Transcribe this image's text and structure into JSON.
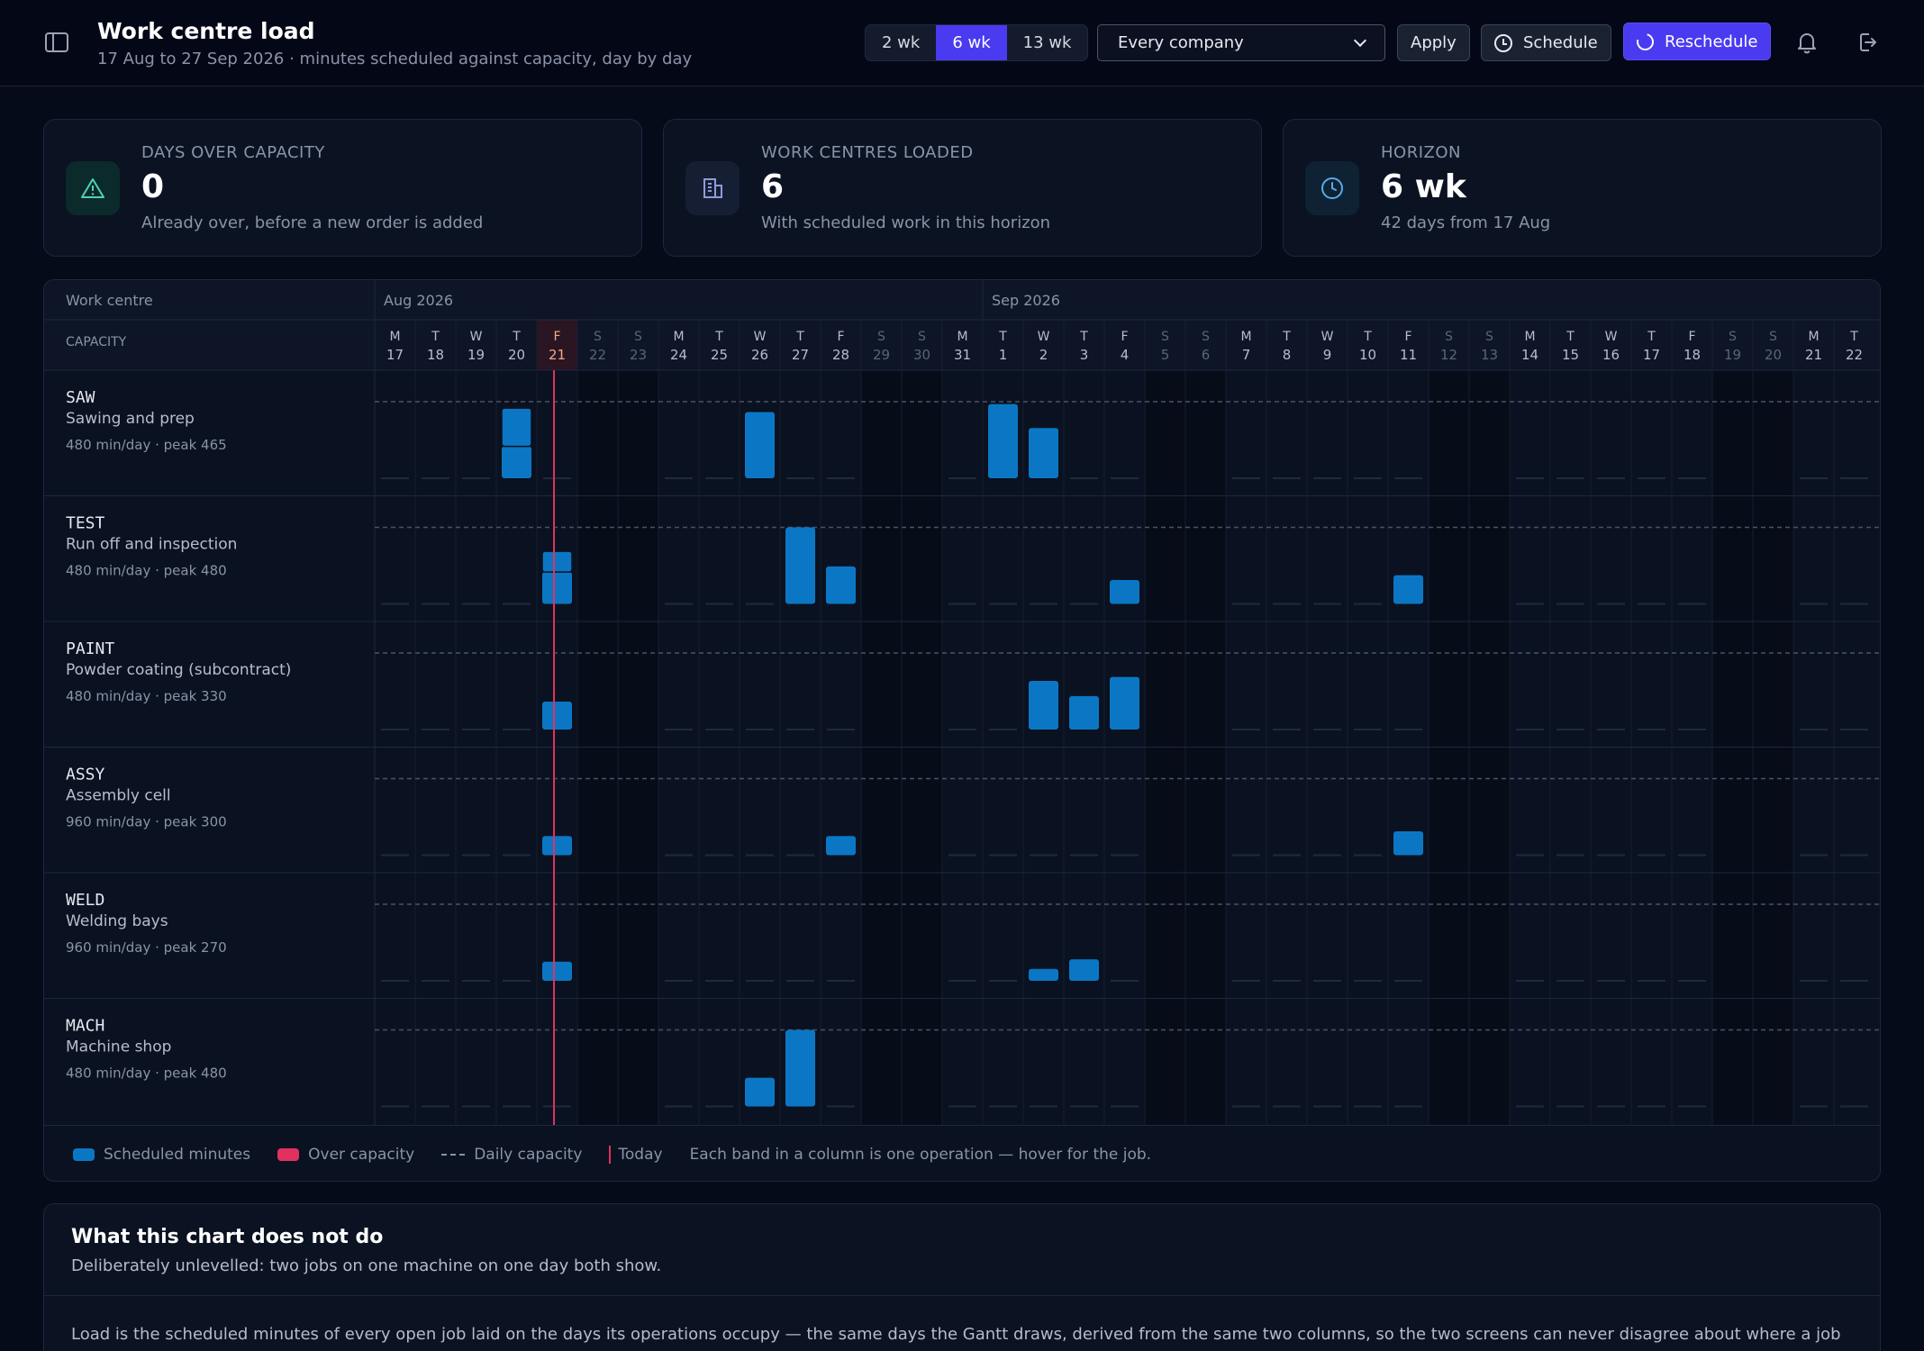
{
  "header": {
    "title": "Work centre load",
    "subtitle": "17 Aug to 27 Sep 2026 · minutes scheduled against capacity, day by day",
    "ranges": [
      "2 wk",
      "6 wk",
      "13 wk"
    ],
    "active_range": 1,
    "company_filter": "Every company",
    "apply_label": "Apply",
    "schedule_label": "Schedule",
    "reschedule_label": "Reschedule"
  },
  "stats": [
    {
      "label": "DAYS OVER CAPACITY",
      "value": "0",
      "note": "Already over, before a new order is added",
      "icon": "warning-icon"
    },
    {
      "label": "WORK CENTRES LOADED",
      "value": "6",
      "note": "With scheduled work in this horizon",
      "icon": "building-icon"
    },
    {
      "label": "HORIZON",
      "value": "6 wk",
      "note": "42 days from 17 Aug",
      "icon": "clock-icon"
    }
  ],
  "chart_data": {
    "type": "bar",
    "header_label": "Work centre",
    "capacity_label": "CAPACITY",
    "months": [
      {
        "label": "Aug 2026",
        "start_index": 0
      },
      {
        "label": "Sep 2026",
        "start_index": 15
      }
    ],
    "days": [
      {
        "dow": "M",
        "d": "17"
      },
      {
        "dow": "T",
        "d": "18"
      },
      {
        "dow": "W",
        "d": "19"
      },
      {
        "dow": "T",
        "d": "20"
      },
      {
        "dow": "F",
        "d": "21"
      },
      {
        "dow": "S",
        "d": "22"
      },
      {
        "dow": "S",
        "d": "23"
      },
      {
        "dow": "M",
        "d": "24"
      },
      {
        "dow": "T",
        "d": "25"
      },
      {
        "dow": "W",
        "d": "26"
      },
      {
        "dow": "T",
        "d": "27"
      },
      {
        "dow": "F",
        "d": "28"
      },
      {
        "dow": "S",
        "d": "29"
      },
      {
        "dow": "S",
        "d": "30"
      },
      {
        "dow": "M",
        "d": "31"
      },
      {
        "dow": "T",
        "d": "1"
      },
      {
        "dow": "W",
        "d": "2"
      },
      {
        "dow": "T",
        "d": "3"
      },
      {
        "dow": "F",
        "d": "4"
      },
      {
        "dow": "S",
        "d": "5"
      },
      {
        "dow": "S",
        "d": "6"
      },
      {
        "dow": "M",
        "d": "7"
      },
      {
        "dow": "T",
        "d": "8"
      },
      {
        "dow": "W",
        "d": "9"
      },
      {
        "dow": "T",
        "d": "10"
      },
      {
        "dow": "F",
        "d": "11"
      },
      {
        "dow": "S",
        "d": "12"
      },
      {
        "dow": "S",
        "d": "13"
      },
      {
        "dow": "M",
        "d": "14"
      },
      {
        "dow": "T",
        "d": "15"
      },
      {
        "dow": "W",
        "d": "16"
      },
      {
        "dow": "T",
        "d": "17"
      },
      {
        "dow": "F",
        "d": "18"
      },
      {
        "dow": "S",
        "d": "19"
      },
      {
        "dow": "S",
        "d": "20"
      },
      {
        "dow": "M",
        "d": "21"
      },
      {
        "dow": "T",
        "d": "22"
      }
    ],
    "today_index": 4,
    "work_centres": [
      {
        "code": "SAW",
        "name": "Sawing and prep",
        "capacity_note": "480 min/day · peak 465",
        "capacity": 480,
        "loads": [
          {
            "day": 3,
            "bands": [
              200,
              240
            ]
          },
          {
            "day": 9,
            "bands": [
              415
            ]
          },
          {
            "day": 15,
            "bands": [
              465
            ]
          },
          {
            "day": 16,
            "bands": [
              315
            ]
          }
        ]
      },
      {
        "code": "TEST",
        "name": "Run off and inspection",
        "capacity_note": "480 min/day · peak 480",
        "capacity": 480,
        "loads": [
          {
            "day": 4,
            "bands": [
              200,
              130
            ]
          },
          {
            "day": 10,
            "bands": [
              480
            ]
          },
          {
            "day": 11,
            "bands": [
              235
            ]
          },
          {
            "day": 18,
            "bands": [
              150
            ]
          },
          {
            "day": 25,
            "bands": [
              180
            ]
          }
        ]
      },
      {
        "code": "PAINT",
        "name": "Powder coating (subcontract)",
        "capacity_note": "480 min/day · peak 330",
        "capacity": 480,
        "loads": [
          {
            "day": 4,
            "bands": [
              175
            ]
          },
          {
            "day": 16,
            "bands": [
              305
            ]
          },
          {
            "day": 17,
            "bands": [
              210
            ]
          },
          {
            "day": 18,
            "bands": [
              330
            ]
          }
        ]
      },
      {
        "code": "ASSY",
        "name": "Assembly cell",
        "capacity_note": "960 min/day · peak 300",
        "capacity": 960,
        "loads": [
          {
            "day": 4,
            "bands": [
              240
            ]
          },
          {
            "day": 11,
            "bands": [
              240
            ]
          },
          {
            "day": 25,
            "bands": [
              300
            ]
          }
        ]
      },
      {
        "code": "WELD",
        "name": "Welding bays",
        "capacity_note": "960 min/day · peak 270",
        "capacity": 960,
        "loads": [
          {
            "day": 4,
            "bands": [
              240
            ]
          },
          {
            "day": 16,
            "bands": [
              150
            ]
          },
          {
            "day": 17,
            "bands": [
              270
            ]
          }
        ]
      },
      {
        "code": "MACH",
        "name": "Machine shop",
        "capacity_note": "480 min/day · peak 480",
        "capacity": 480,
        "loads": [
          {
            "day": 9,
            "bands": [
              180
            ]
          },
          {
            "day": 10,
            "bands": [
              480
            ]
          }
        ]
      }
    ],
    "colors": {
      "scheduled": "#0b77c4",
      "over": "#e0315e",
      "today": "#e0315e"
    },
    "legend": {
      "scheduled": "Scheduled minutes",
      "over": "Over capacity",
      "capacity": "Daily capacity",
      "today": "Today",
      "hint": "Each band in a column is one operation — hover for the job."
    }
  },
  "note": {
    "title": "What this chart does not do",
    "subtitle": "Deliberately unlevelled: two jobs on one machine on one day both show.",
    "body": "Load is the scheduled minutes of every open job laid on the days its operations occupy — the same days the Gantt draws, derived from the same two columns, so the two screens can never disagree about where a job"
  }
}
